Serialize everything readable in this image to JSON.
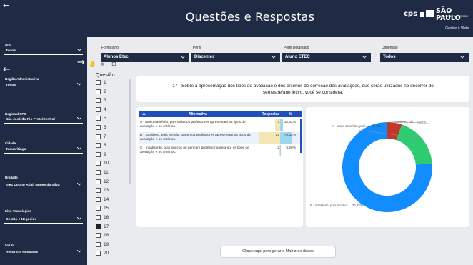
{
  "header": {
    "title": "Questões e Respostas",
    "back_glyph": "←",
    "logo_cps": "cps",
    "logo_sp": "SÃO PAULO",
    "logo_sp_sub": "GOVERNO DO ESTADO",
    "subtitle": "Gestão à Vista"
  },
  "sidebar": {
    "nav_left": "←",
    "nav_right": "→",
    "filters": [
      {
        "label": "Ano",
        "value": "Todos"
      },
      {
        "label": "Região Administrativa",
        "value": "Todos"
      },
      {
        "label": "Regional CPS",
        "value": "São José do Rio Preto/Central"
      },
      {
        "label": "Cidade",
        "value": "Taquaritinga"
      },
      {
        "label": "Unidade",
        "value": "Etec Doutor Adail Nunes da Silva"
      },
      {
        "label": "Eixo Tecnológico",
        "value": "Gestão e Negócios"
      },
      {
        "label": "Curso",
        "value": "Recursos Humanos"
      }
    ]
  },
  "top_filters": {
    "formulario": {
      "label": "Formulário",
      "value": "Alunos Etec"
    },
    "perfil": {
      "label": "Perfil",
      "value": "Discentes"
    },
    "perfil_detalhado": {
      "label": "Perfil Detalhado",
      "value": "Aluno ETEC"
    },
    "dimensao": {
      "label": "Dimensão",
      "value": "Todos"
    }
  },
  "questao": {
    "title": "Questão",
    "items": [
      "1",
      "2",
      "3",
      "4",
      "5",
      "6",
      "7",
      "8",
      "9",
      "10",
      "11",
      "12",
      "13",
      "14",
      "15",
      "16",
      "17",
      "18",
      "19",
      "20"
    ],
    "selected": "17"
  },
  "question_text": "17 - Sobre a apresentação dos tipos de avaliação e dos critérios de correção das avaliações, que serão utilizados no decorrer do semestre/ano letivo, você se considera:",
  "table": {
    "headers": {
      "alternativa": "Alternativa",
      "respostas": "Respostas",
      "pct": "%"
    },
    "rows": [
      {
        "alternativa": "A - Muito satisfeito, pois todos os professores apresentam os tipos de avaliação e os critérios.",
        "respostas": "7",
        "pct": "18,42%"
      },
      {
        "alternativa": "B - Satisfeito, pois a maior parte dos professores apresentam os tipos de avaliação e os critérios.",
        "respostas": "29",
        "pct": "76,32%"
      },
      {
        "alternativa": "C - Insatisfeito, pois poucos ou nenhum professor apresenta os tipos de avaliação e os critérios.",
        "respostas": "2",
        "pct": "5,26%"
      }
    ]
  },
  "chart_data": {
    "type": "pie",
    "variant": "donut",
    "slices": [
      {
        "label": "C - Insatisfeito, poi...",
        "value": 5.26,
        "display": "5,26%",
        "color": "#c0392b"
      },
      {
        "label": "A - Muito satisfeito, pois t...",
        "value": 18.42,
        "display": "18,42%",
        "color": "#2ecc71"
      },
      {
        "label": "B - Satisfeito, pois a maior ...",
        "value": 76.32,
        "display": "76,32%",
        "color": "#118dff"
      }
    ]
  },
  "matrix_button": "Clique aqui para gerar a Matriz de dados",
  "vis_icons": [
    "🔔",
    "≡",
    "⊡",
    "⋯"
  ],
  "colors": {
    "navy": "#1f2a44",
    "table_header": "#1f4fbf",
    "bar_respostas": "#f4e6b0",
    "bar_pct": "#9fd6ef"
  }
}
